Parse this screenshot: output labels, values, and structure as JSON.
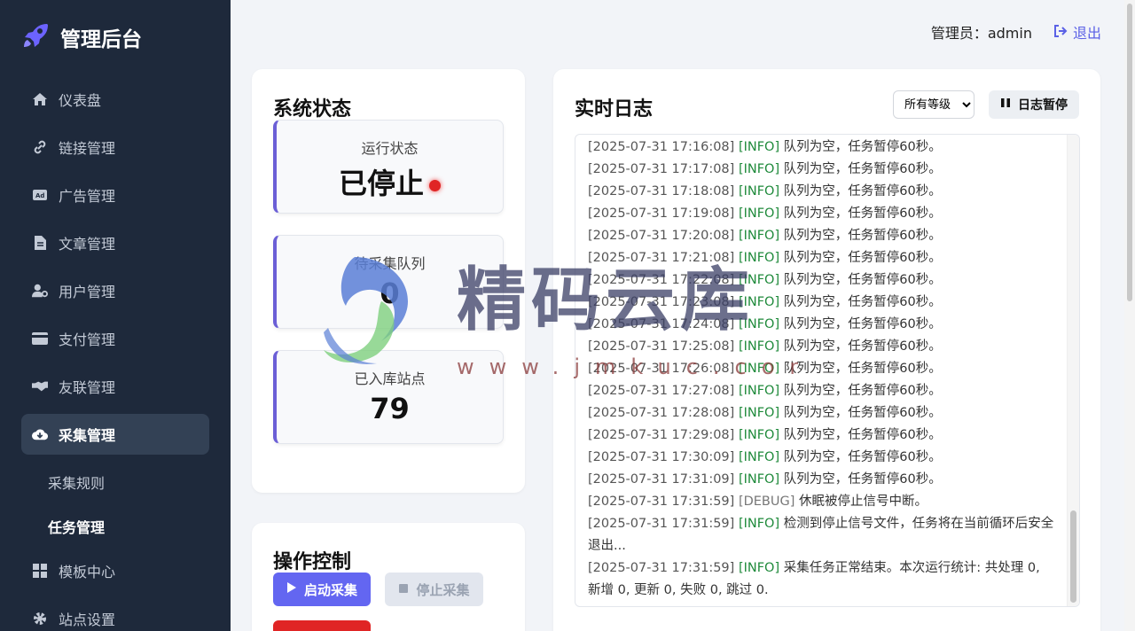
{
  "brand": {
    "title": "管理后台"
  },
  "nav": [
    {
      "label": "仪表盘",
      "icon": "home-icon"
    },
    {
      "label": "链接管理",
      "icon": "link-icon"
    },
    {
      "label": "广告管理",
      "icon": "ad-icon"
    },
    {
      "label": "文章管理",
      "icon": "file-icon"
    },
    {
      "label": "用户管理",
      "icon": "user-gear-icon"
    },
    {
      "label": "支付管理",
      "icon": "credit-card-icon"
    },
    {
      "label": "友联管理",
      "icon": "handshake-icon"
    },
    {
      "label": "采集管理",
      "icon": "cloud-download-icon"
    },
    {
      "label": "模板中心",
      "icon": "grid-icon"
    },
    {
      "label": "站点设置",
      "icon": "gear-icon"
    }
  ],
  "subnav": [
    {
      "label": "采集规则"
    },
    {
      "label": "任务管理"
    }
  ],
  "header": {
    "admin_label": "管理员：admin",
    "logout_label": "退出"
  },
  "status": {
    "title": "系统状态",
    "run_label": "运行状态",
    "run_value": "已停止",
    "queue_label": "待采集队列",
    "queue_value": "0",
    "sites_label": "已入库站点",
    "sites_value": "79"
  },
  "control": {
    "title": "操作控制",
    "start_label": "启动采集",
    "stop_label": "停止采集"
  },
  "log": {
    "title": "实时日志",
    "level_select": "所有等级",
    "pause_label": "日志暂停",
    "entries": [
      {
        "ts": "[2025-07-31 17:16:08]",
        "level": "[INFO]",
        "msg": "队列为空，任务暂停60秒。"
      },
      {
        "ts": "[2025-07-31 17:17:08]",
        "level": "[INFO]",
        "msg": "队列为空，任务暂停60秒。"
      },
      {
        "ts": "[2025-07-31 17:18:08]",
        "level": "[INFO]",
        "msg": "队列为空，任务暂停60秒。"
      },
      {
        "ts": "[2025-07-31 17:19:08]",
        "level": "[INFO]",
        "msg": "队列为空，任务暂停60秒。"
      },
      {
        "ts": "[2025-07-31 17:20:08]",
        "level": "[INFO]",
        "msg": "队列为空，任务暂停60秒。"
      },
      {
        "ts": "[2025-07-31 17:21:08]",
        "level": "[INFO]",
        "msg": "队列为空，任务暂停60秒。"
      },
      {
        "ts": "[2025-07-31 17:22:08]",
        "level": "[INFO]",
        "msg": "队列为空，任务暂停60秒。"
      },
      {
        "ts": "[2025-07-31 17:23:08]",
        "level": "[INFO]",
        "msg": "队列为空，任务暂停60秒。"
      },
      {
        "ts": "[2025-07-31 17:24:08]",
        "level": "[INFO]",
        "msg": "队列为空，任务暂停60秒。"
      },
      {
        "ts": "[2025-07-31 17:25:08]",
        "level": "[INFO]",
        "msg": "队列为空，任务暂停60秒。"
      },
      {
        "ts": "[2025-07-31 17:26:08]",
        "level": "[INFO]",
        "msg": "队列为空，任务暂停60秒。"
      },
      {
        "ts": "[2025-07-31 17:27:08]",
        "level": "[INFO]",
        "msg": "队列为空，任务暂停60秒。"
      },
      {
        "ts": "[2025-07-31 17:28:08]",
        "level": "[INFO]",
        "msg": "队列为空，任务暂停60秒。"
      },
      {
        "ts": "[2025-07-31 17:29:08]",
        "level": "[INFO]",
        "msg": "队列为空，任务暂停60秒。"
      },
      {
        "ts": "[2025-07-31 17:30:09]",
        "level": "[INFO]",
        "msg": "队列为空，任务暂停60秒。"
      },
      {
        "ts": "[2025-07-31 17:31:09]",
        "level": "[INFO]",
        "msg": "队列为空，任务暂停60秒。"
      },
      {
        "ts": "[2025-07-31 17:31:59]",
        "level": "[DEBUG]",
        "msg": "休眠被停止信号中断。"
      },
      {
        "ts": "[2025-07-31 17:31:59]",
        "level": "[INFO]",
        "msg": "检测到停止信号文件，任务将在当前循环后安全退出..."
      },
      {
        "ts": "[2025-07-31 17:31:59]",
        "level": "[INFO]",
        "msg": "采集任务正常结束。本次运行统计: 共处理 0, 新增 0, 更新 0, 失败 0, 跳过 0."
      }
    ]
  },
  "watermark": {
    "text": "精码云库",
    "url": "www.jmkuc.com"
  },
  "colors": {
    "accent": "#6366f1",
    "sidebar": "#1e293b",
    "danger": "#e02525",
    "info": "#1f8a3b"
  }
}
